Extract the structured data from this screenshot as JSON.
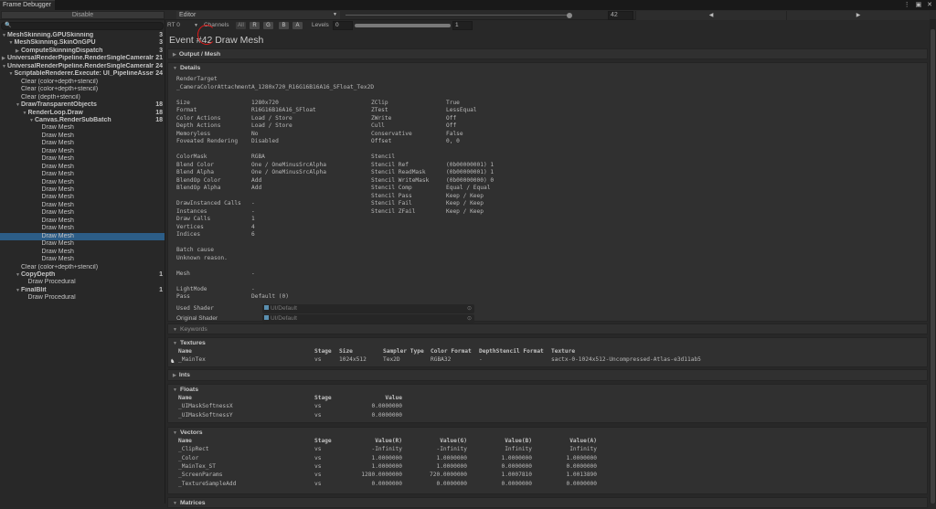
{
  "window": {
    "tab": "Frame Debugger",
    "controls": "⋮ ▣ ✕"
  },
  "top": {
    "disable": "Disable",
    "target": "Editor",
    "event_index": "42",
    "event_fraction": 0.91,
    "prev": "◀",
    "next": "▶"
  },
  "search": {
    "icon": "🔍",
    "placeholder": ""
  },
  "tree": [
    {
      "label": "MeshSkinning.GPUSkinning",
      "count": "3",
      "depth": 0,
      "arrow": "open",
      "bold": true
    },
    {
      "label": "MeshSkinning.SkinOnGPU",
      "count": "3",
      "depth": 1,
      "arrow": "open",
      "bold": true
    },
    {
      "label": "ComputeSkinningDispatch",
      "count": "3",
      "depth": 2,
      "arrow": "closed",
      "bold": true
    },
    {
      "label": "UniversalRenderPipeline.RenderSingleCameraInternal",
      "count": "21",
      "depth": 0,
      "arrow": "closed",
      "bold": true
    },
    {
      "label": "UniversalRenderPipeline.RenderSingleCameraInternal",
      "count": "24",
      "depth": 0,
      "arrow": "open",
      "bold": true
    },
    {
      "label": "ScriptableRenderer.Execute: UI_PipelineAsset_Renderer",
      "count": "24",
      "depth": 1,
      "arrow": "open",
      "bold": true
    },
    {
      "label": "Clear (color+depth+stencil)",
      "depth": 2
    },
    {
      "label": "Clear (color+depth+stencil)",
      "depth": 2
    },
    {
      "label": "Clear (depth+stencil)",
      "depth": 2
    },
    {
      "label": "DrawTransparentObjects",
      "count": "18",
      "depth": 2,
      "arrow": "open",
      "bold": true
    },
    {
      "label": "RenderLoop.Draw",
      "count": "18",
      "depth": 3,
      "arrow": "open",
      "bold": true
    },
    {
      "label": "Canvas.RenderSubBatch",
      "count": "18",
      "depth": 4,
      "arrow": "open",
      "bold": true
    },
    {
      "label": "Draw Mesh",
      "depth": 5
    },
    {
      "label": "Draw Mesh",
      "depth": 5
    },
    {
      "label": "Draw Mesh",
      "depth": 5
    },
    {
      "label": "Draw Mesh",
      "depth": 5
    },
    {
      "label": "Draw Mesh",
      "depth": 5
    },
    {
      "label": "Draw Mesh",
      "depth": 5
    },
    {
      "label": "Draw Mesh",
      "depth": 5
    },
    {
      "label": "Draw Mesh",
      "depth": 5
    },
    {
      "label": "Draw Mesh",
      "depth": 5
    },
    {
      "label": "Draw Mesh",
      "depth": 5
    },
    {
      "label": "Draw Mesh",
      "depth": 5
    },
    {
      "label": "Draw Mesh",
      "depth": 5
    },
    {
      "label": "Draw Mesh",
      "depth": 5
    },
    {
      "label": "Draw Mesh",
      "depth": 5
    },
    {
      "label": "Draw Mesh",
      "depth": 5,
      "selected": true
    },
    {
      "label": "Draw Mesh",
      "depth": 5
    },
    {
      "label": "Draw Mesh",
      "depth": 5
    },
    {
      "label": "Draw Mesh",
      "depth": 5
    },
    {
      "label": "Clear (color+depth+stencil)",
      "depth": 2
    },
    {
      "label": "CopyDepth",
      "count": "1",
      "depth": 2,
      "arrow": "open",
      "bold": true
    },
    {
      "label": "Draw Procedural",
      "depth": 3
    },
    {
      "label": "FinalBlit",
      "count": "1",
      "depth": 2,
      "arrow": "open",
      "bold": true
    },
    {
      "label": "Draw Procedural",
      "depth": 3
    }
  ],
  "toolbar": {
    "rt": "RT 0",
    "channels": "Channels",
    "ch_all": "All",
    "ch_r": "R",
    "ch_g": "G",
    "ch_b": "B",
    "ch_a": "A",
    "levels": "Levels",
    "level_min": "0",
    "level_max": "1"
  },
  "event_title": "Event #42 Draw Mesh",
  "sections": {
    "output": "Output / Mesh",
    "details": "Details",
    "keywords": "Keywords",
    "textures": "Textures",
    "ints": "Ints",
    "floats": "Floats",
    "vectors": "Vectors",
    "matrices": "Matrices"
  },
  "details": {
    "render_target_label": "RenderTarget",
    "render_target": "_CameraColorAttachmentA_1280x720_R16G16B16A16_SFloat_Tex2D",
    "left": [
      [
        [
          "Size",
          "1280x720"
        ],
        [
          "Format",
          "R16G16B16A16_SFloat"
        ],
        [
          "Color Actions",
          "Load / Store"
        ],
        [
          "Depth Actions",
          "Load / Store"
        ],
        [
          "Memoryless",
          "No"
        ],
        [
          "Foveated Rendering",
          "Disabled"
        ]
      ],
      [
        [
          "ColorMask",
          "RGBA"
        ],
        [
          "Blend Color",
          "One / OneMinusSrcAlpha"
        ],
        [
          "Blend Alpha",
          "One / OneMinusSrcAlpha"
        ],
        [
          "BlendOp Color",
          "Add"
        ],
        [
          "BlendOp Alpha",
          "Add"
        ]
      ],
      [
        [
          "DrawInstanced Calls",
          "-"
        ],
        [
          "Instances",
          "-"
        ],
        [
          "Draw Calls",
          "1"
        ],
        [
          "Vertices",
          "4"
        ],
        [
          "Indices",
          "6"
        ]
      ],
      [
        [
          "Batch cause",
          ""
        ],
        [
          "Unknown reason.",
          ""
        ]
      ],
      [
        [
          "Mesh",
          "-"
        ]
      ],
      [
        [
          "LightMode",
          "-"
        ],
        [
          "Pass",
          "Default (0)"
        ]
      ]
    ],
    "right": [
      [
        [
          "ZClip",
          "True"
        ],
        [
          "ZTest",
          "LessEqual"
        ],
        [
          "ZWrite",
          "Off"
        ],
        [
          "Cull",
          "Off"
        ],
        [
          "Conservative",
          "False"
        ],
        [
          "Offset",
          "0, 0"
        ]
      ],
      [
        [
          "Stencil",
          ""
        ],
        [
          "Stencil Ref",
          "(0b00000001) 1"
        ],
        [
          "Stencil ReadMask",
          "(0b00000001) 1"
        ],
        [
          "Stencil WriteMask",
          "(0b00000000) 0"
        ],
        [
          "Stencil Comp",
          "Equal / Equal"
        ],
        [
          "Stencil Pass",
          "Keep / Keep"
        ],
        [
          "Stencil Fail",
          "Keep / Keep"
        ],
        [
          "Stencil ZFail",
          "Keep / Keep"
        ]
      ]
    ],
    "used_shader_label": "Used Shader",
    "used_shader": "UI/Default",
    "original_shader_label": "Original Shader",
    "original_shader": "UI/Default"
  },
  "textures": {
    "headers": [
      "Name",
      "Stage",
      "Size",
      "Sampler Type",
      "Color Format",
      "DepthStencil Format",
      "Texture"
    ],
    "rows": [
      [
        "_MainTex",
        "vs",
        "1024x512",
        "Tex2D",
        "RGBA32",
        "-",
        "sactx-0-1024x512-Uncompressed-Atlas-e3d11ab5"
      ]
    ]
  },
  "floats": {
    "headers": [
      "Name",
      "Stage",
      "Value"
    ],
    "rows": [
      [
        "_UIMaskSoftnessX",
        "vs",
        "0.0000000"
      ],
      [
        "_UIMaskSoftnessY",
        "vs",
        "0.0000000"
      ]
    ]
  },
  "vectors": {
    "headers": [
      "Name",
      "Stage",
      "Value(R)",
      "Value(G)",
      "Value(B)",
      "Value(A)"
    ],
    "rows": [
      [
        "_ClipRect",
        "vs",
        "-Infinity",
        "-Infinity",
        "Infinity",
        "Infinity"
      ],
      [
        "_Color",
        "vs",
        "1.0000000",
        "1.0000000",
        "1.0000000",
        "1.0000000"
      ],
      [
        "_MainTex_ST",
        "vs",
        "1.0000000",
        "1.0000000",
        "0.0000000",
        "0.0000000"
      ],
      [
        "_ScreenParams",
        "vs",
        "1280.0000000",
        "720.0000000",
        "1.0007810",
        "1.0013890"
      ],
      [
        "_TextureSampleAdd",
        "vs",
        "0.0000000",
        "0.0000000",
        "0.0000000",
        "0.0000000"
      ]
    ]
  }
}
